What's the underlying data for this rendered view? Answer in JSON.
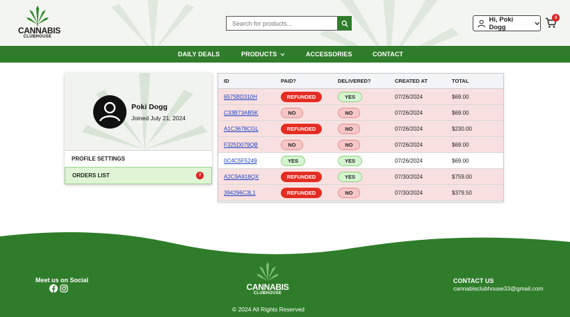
{
  "header": {
    "logo_brand": "CANNABIS",
    "logo_sub": "CLUBHOUSE",
    "search_placeholder": "Search for products...",
    "user_greeting": "Hi, Poki Dogg",
    "cart_count": "3"
  },
  "nav": {
    "items": [
      {
        "label": "DAILY DEALS"
      },
      {
        "label": "PRODUCTS"
      },
      {
        "label": "ACCESSORIES"
      },
      {
        "label": "CONTACT"
      }
    ]
  },
  "profile": {
    "name": "Poki Dogg",
    "joined": "Joined July 21, 2024",
    "menu": {
      "settings": "PROFILE SETTINGS",
      "orders": "ORDERS LIST",
      "orders_count": "7"
    }
  },
  "orders": {
    "columns": [
      "ID",
      "PAID?",
      "DELIVERED?",
      "CREATED AT",
      "TOTAL"
    ],
    "rows": [
      {
        "id": "6575BD310H",
        "paid": "REFUNDED",
        "delivered": "YES",
        "created": "07/26/2024",
        "total": "$69.00"
      },
      {
        "id": "C33B73AB5K",
        "paid": "NO",
        "delivered": "NO",
        "created": "07/26/2024",
        "total": "$69.00"
      },
      {
        "id": "A1C3678CGL",
        "paid": "REFUNDED",
        "delivered": "NO",
        "created": "07/26/2024",
        "total": "$230.00"
      },
      {
        "id": "F325D079QB",
        "paid": "NO",
        "delivered": "NO",
        "created": "07/26/2024",
        "total": "$69.00"
      },
      {
        "id": "0C4C5F5249",
        "paid": "YES",
        "delivered": "YES",
        "created": "07/26/2024",
        "total": "$69.00"
      },
      {
        "id": "A2C9A918QX",
        "paid": "REFUNDED",
        "delivered": "YES",
        "created": "07/30/2024",
        "total": "$759.00"
      },
      {
        "id": "394296C3L1",
        "paid": "REFUNDED",
        "delivered": "NO",
        "created": "07/30/2024",
        "total": "$379.50"
      }
    ]
  },
  "footer": {
    "social_title": "Meet us on Social",
    "logo_brand": "CANNABIS",
    "logo_sub": "CLUBHOUSE",
    "copyright": "© 2024 All Rights Reserved",
    "contact_title": "CONTACT US",
    "contact_email": "cannabisclubhouse33@gmail.com"
  },
  "colors": {
    "brand_green": "#2f7d2a",
    "refunded_red": "#e42d22",
    "row_bad_bg": "#f9e0e0",
    "link_blue": "#1a3fc4"
  },
  "icons": {
    "search": "search-icon",
    "user": "user-icon",
    "chevron": "chevron-down-icon",
    "cart": "cart-icon",
    "facebook": "facebook-icon",
    "instagram": "instagram-icon",
    "leaf": "cannabis-leaf-icon"
  }
}
